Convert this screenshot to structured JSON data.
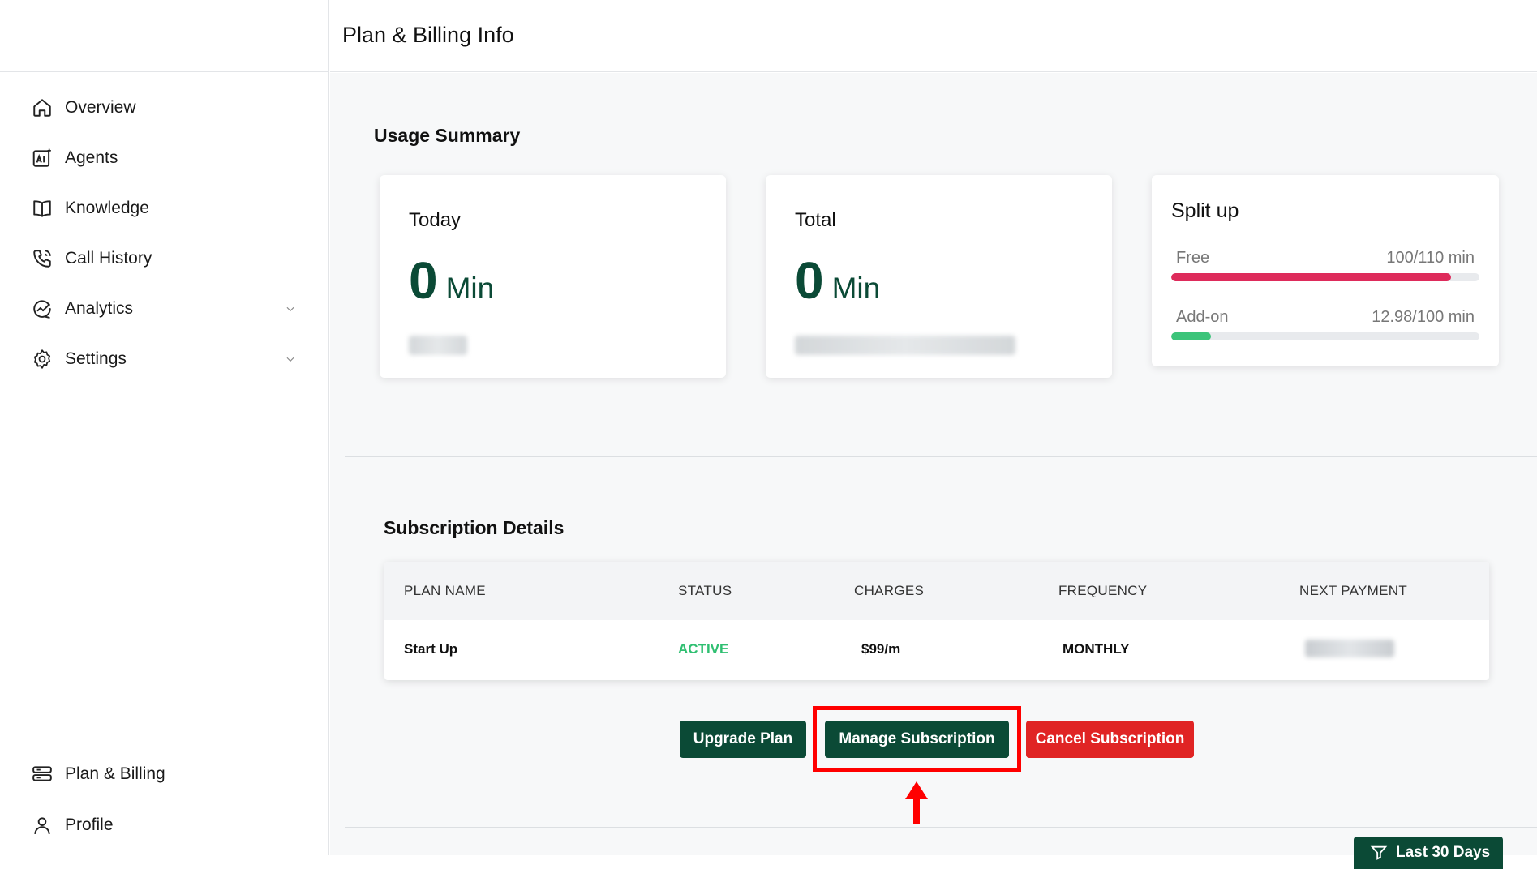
{
  "header": {
    "title": "Plan & Billing Info"
  },
  "sidebar": {
    "items": [
      {
        "label": "Overview",
        "icon": "home-icon"
      },
      {
        "label": "Agents",
        "icon": "ai-icon"
      },
      {
        "label": "Knowledge",
        "icon": "book-icon"
      },
      {
        "label": "Call History",
        "icon": "phone-icon"
      },
      {
        "label": "Analytics",
        "icon": "analytics-icon",
        "expandable": true
      },
      {
        "label": "Settings",
        "icon": "gear-icon",
        "expandable": true
      }
    ],
    "bottom_items": [
      {
        "label": "Plan & Billing",
        "icon": "billing-icon"
      },
      {
        "label": "Profile",
        "icon": "user-icon"
      }
    ]
  },
  "usage": {
    "title": "Usage Summary",
    "today": {
      "label": "Today",
      "value": "0",
      "unit": "Min"
    },
    "total": {
      "label": "Total",
      "value": "0",
      "unit": "Min"
    },
    "split": {
      "title": "Split up",
      "free": {
        "label": "Free",
        "value": "100/110 min",
        "fraction": 0.909
      },
      "addon": {
        "label": "Add-on",
        "value": "12.98/100 min",
        "fraction": 0.1298
      }
    }
  },
  "subscription": {
    "title": "Subscription Details",
    "columns": [
      "PLAN NAME",
      "STATUS",
      "CHARGES",
      "FREQUENCY",
      "NEXT PAYMENT"
    ],
    "row": {
      "plan": "Start Up",
      "status": "ACTIVE",
      "charges": "$99/m",
      "frequency": "MONTHLY"
    }
  },
  "buttons": {
    "upgrade": "Upgrade Plan",
    "manage": "Manage Subscription",
    "cancel": "Cancel Subscription"
  },
  "bottom_button": {
    "label": "Last 30 Days"
  },
  "colors": {
    "brand_green": "#0b4a36",
    "danger_red": "#e02424",
    "status_green": "#2fbf71",
    "free_bar": "#de2b5b",
    "addon_bar": "#3cc47a",
    "highlight": "#ff0000"
  }
}
